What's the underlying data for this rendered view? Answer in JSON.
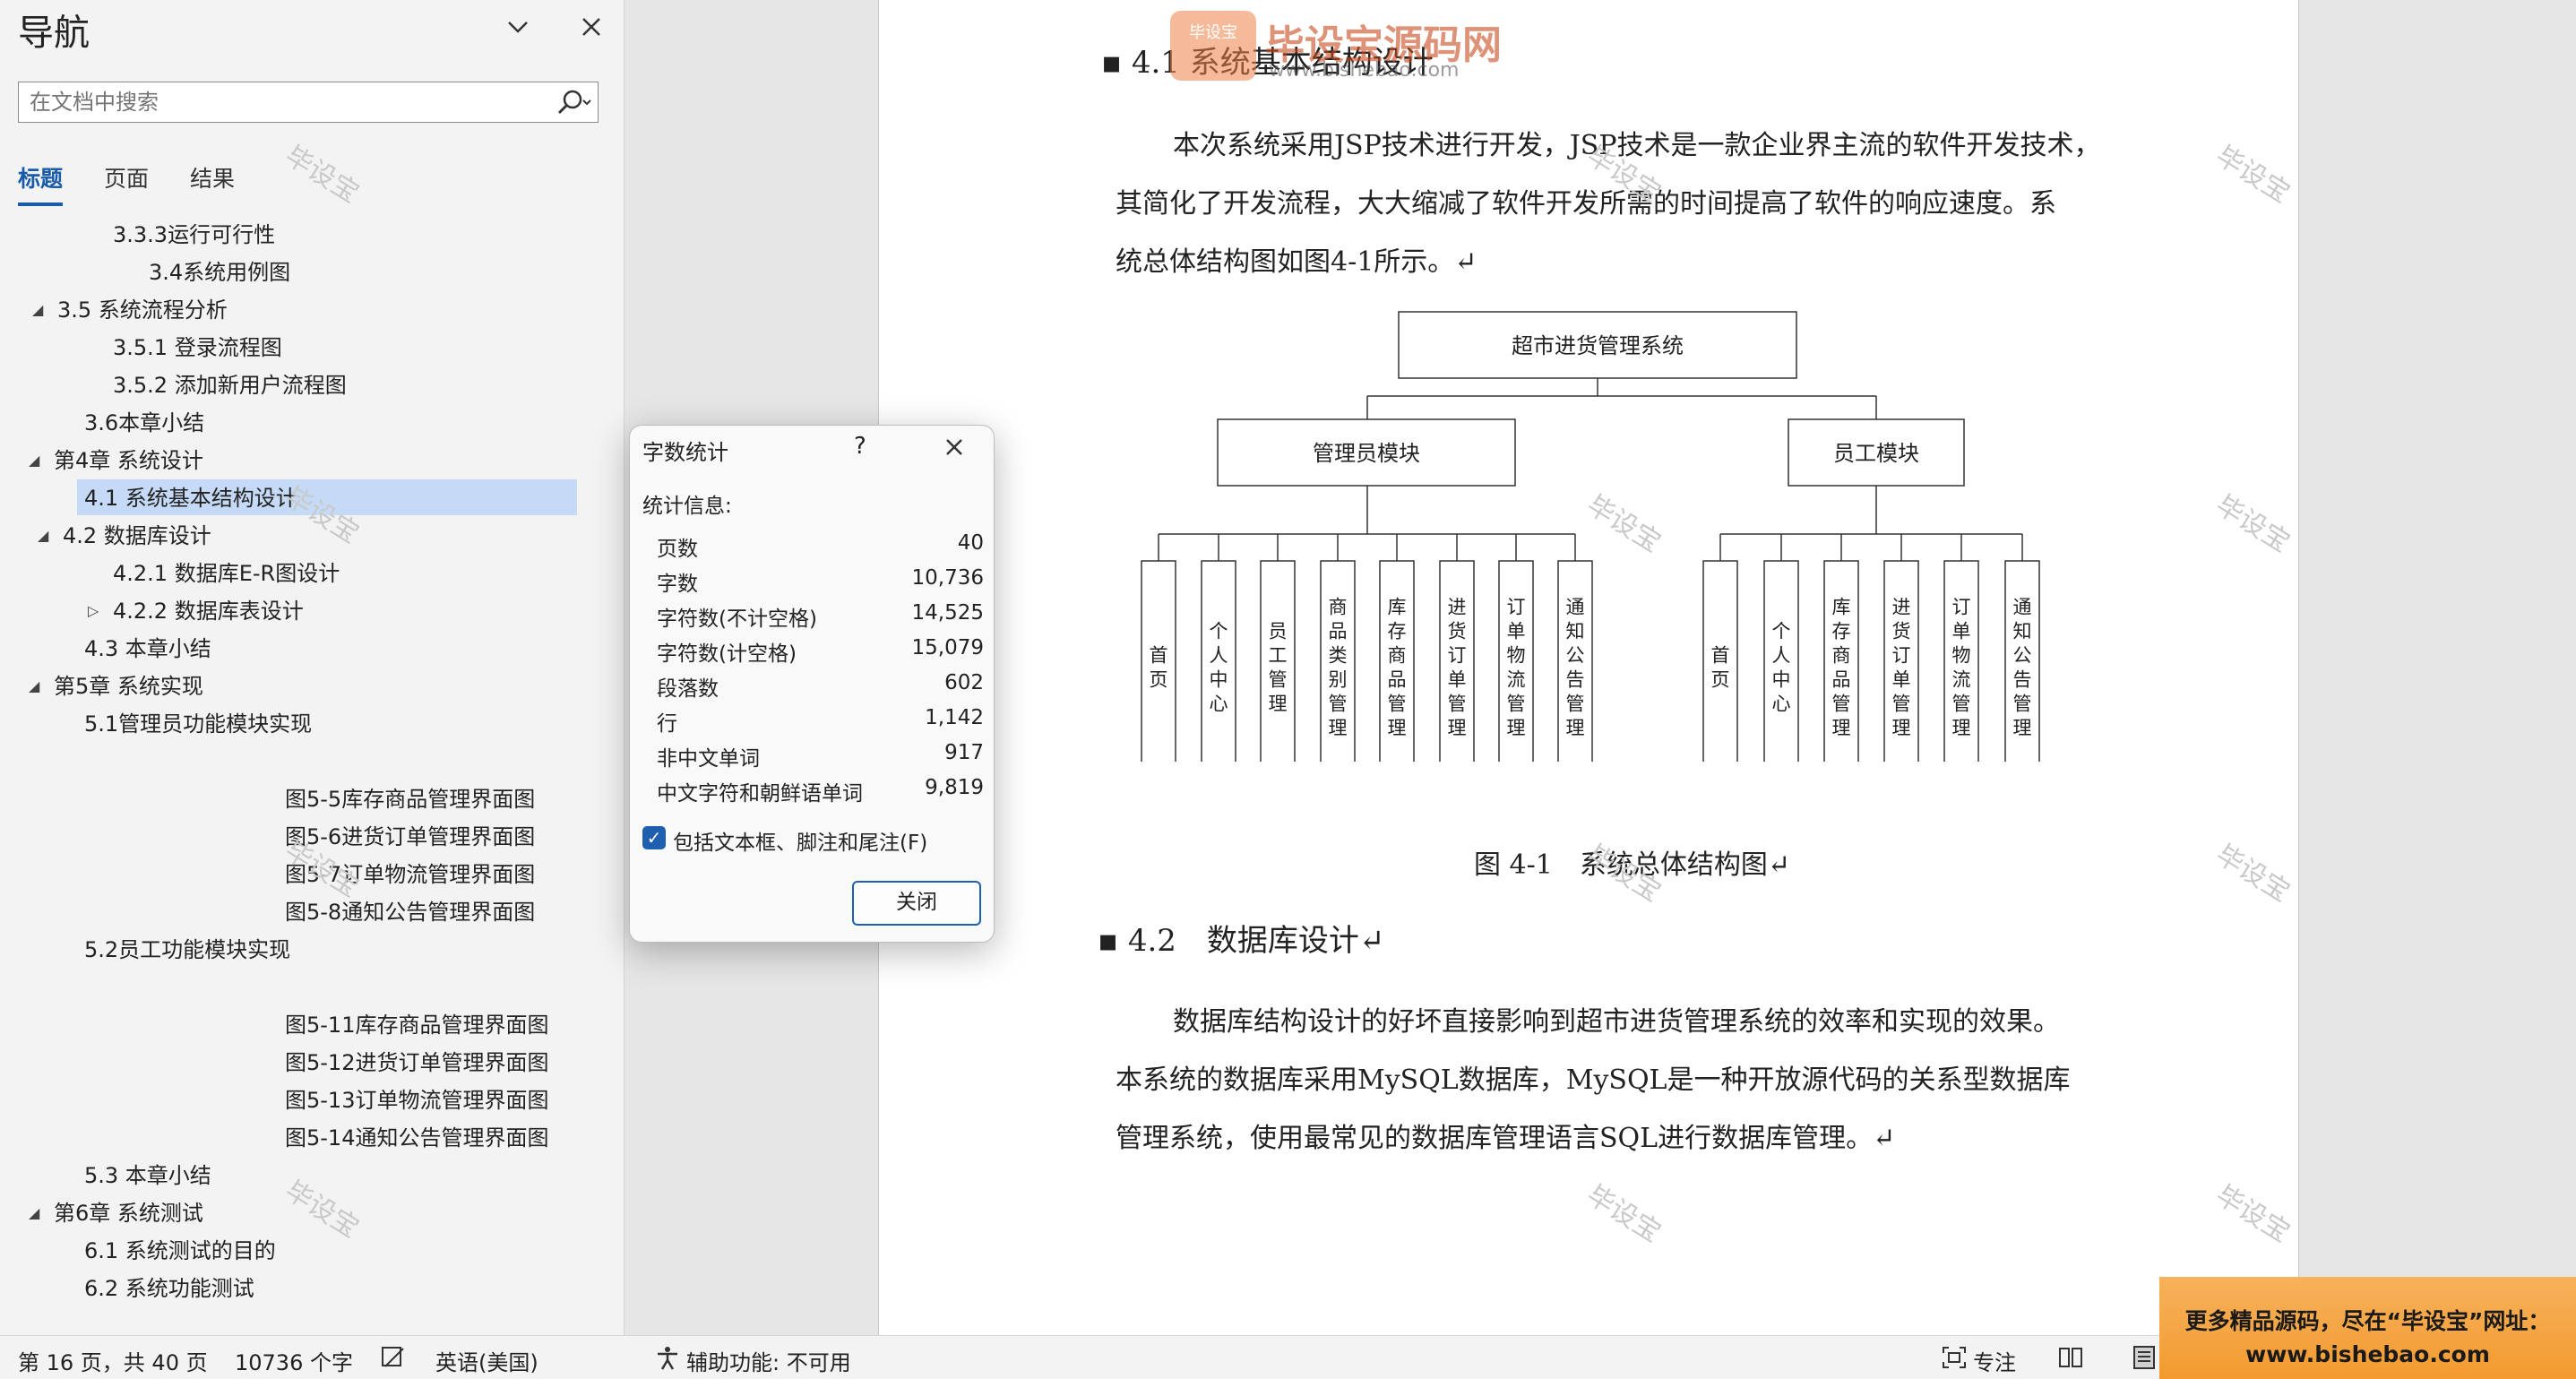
{
  "nav": {
    "title": "导航",
    "search_placeholder": "在文档中搜索",
    "tabs": [
      "标题",
      "页面",
      "结果"
    ],
    "items": [
      "3.3.3运行可行性",
      "3.4系统用例图",
      "3.5 系统流程分析",
      "3.5.1 登录流程图",
      "3.5.2 添加新用户流程图",
      "3.6本章小结",
      "第4章 系统设计",
      "4.1 系统基本结构设计",
      "4.2 数据库设计",
      "4.2.1 数据库E-R图设计",
      "4.2.2 数据库表设计",
      "4.3 本章小结",
      "第5章 系统实现",
      "5.1管理员功能模块实现",
      "图5-5库存商品管理界面图",
      "图5-6进货订单管理界面图",
      "图5-7订单物流管理界面图",
      "图5-8通知公告管理界面图",
      "5.2员工功能模块实现",
      "图5-11库存商品管理界面图",
      "图5-12进货订单管理界面图",
      "图5-13订单物流管理界面图",
      "图5-14通知公告管理界面图",
      "5.3 本章小结",
      "第6章 系统测试",
      "6.1 系统测试的目的",
      "6.2 系统功能测试"
    ]
  },
  "watermark": "毕设宝",
  "logo": {
    "name": "毕设宝源码网",
    "url": "www.bishebao.com",
    "badge": "毕设宝"
  },
  "doc": {
    "heading_41": "4.1 系统基本结构设计",
    "para1": [
      "本次系统采用JSP技术进行开发，JSP技术是一款企业界主流的软件开发技术，",
      "其简化了开发流程，大大缩减了软件开发所需的时间提高了软件的响应速度。系",
      "统总体结构图如图4-1所示。↵"
    ],
    "diagram": {
      "root": "超市进货管理系统",
      "admin": "管理员模块",
      "admin_leaves": [
        "首页",
        "个人中心",
        "员工管理",
        "商品类别管理",
        "库存商品管理",
        "进货订单管理",
        "订单物流管理",
        "通知公告管理"
      ],
      "staff": "员工模块",
      "staff_leaves": [
        "首页",
        "个人中心",
        "库存商品管理",
        "进货订单管理",
        "订单物流管理",
        "通知公告管理"
      ]
    },
    "caption": "图 4-1　系统总体结构图↵",
    "heading_42": "4.2　数据库设计↵",
    "para2": [
      "数据库结构设计的好坏直接影响到超市进货管理系统的效率和实现的效果。",
      "本系统的数据库采用MySQL数据库，MySQL是一种开放源代码的关系型数据库",
      "管理系统，使用最常见的数据库管理语言SQL进行数据库管理。↵"
    ]
  },
  "dialog": {
    "title": "字数统计",
    "help": "?",
    "stats_label": "统计信息:",
    "rows": [
      {
        "label": "页数",
        "value": "40"
      },
      {
        "label": "字数",
        "value": "10,736"
      },
      {
        "label": "字符数(不计空格)",
        "value": "14,525"
      },
      {
        "label": "字符数(计空格)",
        "value": "15,079"
      },
      {
        "label": "段落数",
        "value": "602"
      },
      {
        "label": "行",
        "value": "1,142"
      },
      {
        "label": "非中文单词",
        "value": "917"
      },
      {
        "label": "中文字符和朝鲜语单词",
        "value": "9,819"
      }
    ],
    "checkbox_label": "包括文本框、脚注和尾注(F)",
    "checkbox_checked": true,
    "close_label": "关闭"
  },
  "status": {
    "page": "第 16 页，共 40 页",
    "words": "10736 个字",
    "lang": "英语(美国)",
    "access": "辅助功能: 不可用",
    "focus": "专注"
  },
  "banner": {
    "line1": "更多精品源码，尽在“毕设宝”网址：",
    "line2": "www.bishebao.com"
  }
}
